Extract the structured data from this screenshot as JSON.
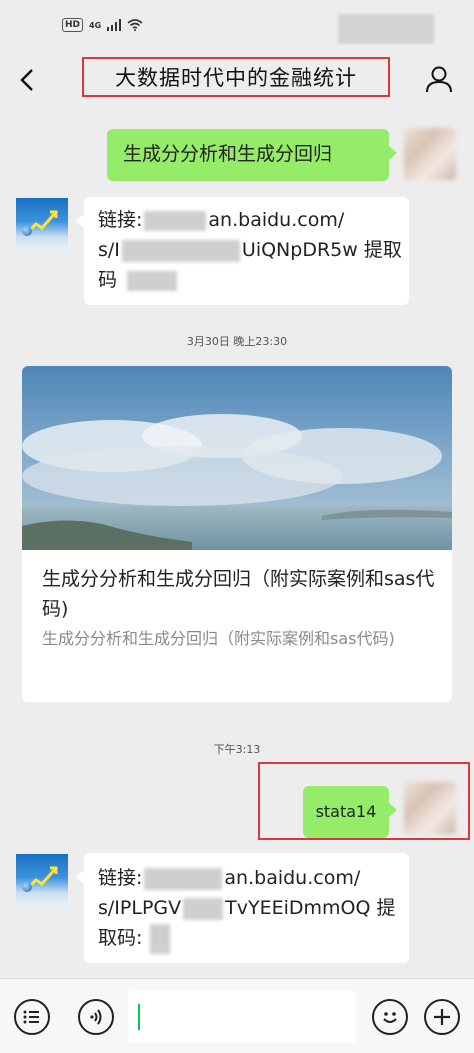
{
  "status_bar": {
    "network_badge": "HD",
    "network_type": "4G"
  },
  "nav": {
    "title": "大数据时代中的金融统计"
  },
  "messages": [
    {
      "type": "sent_text",
      "text": "生成分分析和生成分回归"
    },
    {
      "type": "received_link",
      "prefix": "链接:",
      "line1_visible": "an.baidu.com/",
      "line2_start": "s/I",
      "line2_visible": "UiQNpDR5w 提取",
      "line3": "码"
    },
    {
      "type": "timestamp",
      "text": "3月30日 晚上23:30"
    },
    {
      "type": "card",
      "title": "生成分分析和生成分回归（附实际案例和sas代码)",
      "desc": "生成分分析和生成分回归（附实际案例和sas代码)"
    },
    {
      "type": "timestamp",
      "text": "下午3:13"
    },
    {
      "type": "sent_text",
      "text": "stata14"
    },
    {
      "type": "received_link",
      "prefix": "链接:",
      "line1_visible": "an.baidu.com/",
      "line2_start": "s/IPLPGV",
      "line2_visible": "TvYEEiDmmOQ 提",
      "line3": "取码:"
    }
  ],
  "input": {
    "value": ""
  },
  "colors": {
    "sent_bubble": "#95ec69",
    "received_bubble": "#ffffff",
    "background": "#ededed",
    "highlight_box": "#d9363e",
    "caret": "#07c160"
  },
  "icons": {
    "back": "chevron-left-icon",
    "profile": "person-icon",
    "voice": "voice-icon",
    "menu": "list-icon",
    "emoji": "emoji-icon",
    "plus": "plus-icon"
  }
}
